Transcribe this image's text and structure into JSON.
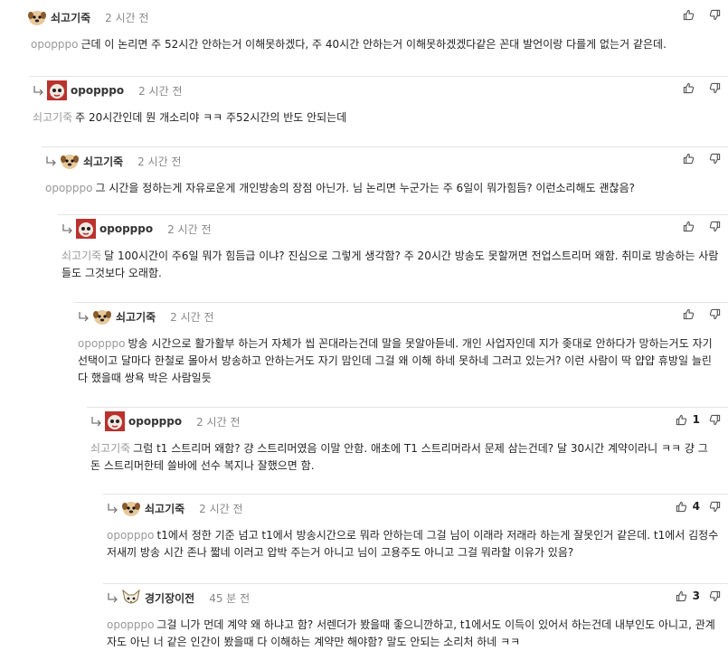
{
  "comments": [
    {
      "author": "쇠고기죽",
      "avatar": "dog-avatar-icon",
      "time": "2 시간 전",
      "mention": "opopppo",
      "text": "근데 이 논리면 주 52시간 안하는거 이해못하겠다, 주 40시간 안하는거 이해못하겠겠다같은 꼰대 발언이랑 다를게 없는거 같은데.",
      "likes": ""
    },
    {
      "author": "opopppo",
      "avatar": "face-avatar-icon",
      "time": "2 시간 전",
      "mention": "쇠고기죽",
      "text": "주 20시간인데 뭔 개소리야 ㅋㅋ 주52시간의 반도 안되는데",
      "likes": ""
    },
    {
      "author": "쇠고기죽",
      "avatar": "dog-avatar-icon",
      "time": "2 시간 전",
      "mention": "opopppo",
      "text": "그 시간을 정하는게 자유로운게 개인방송의 장점 아닌가. 님 논리면 누군가는 주 6일이 뭐가힘듬? 이런소리해도 괜찮음?",
      "likes": ""
    },
    {
      "author": "opopppo",
      "avatar": "face-avatar-icon",
      "time": "2 시간 전",
      "mention": "쇠고기죽",
      "text": "달 100시간이 주6일 뭐가 힘듬급 이냐? 진심으로 그렇게 생각함? 주 20시간 방송도 못할꺼면 전업스트리머 왜함. 취미로 방송하는 사람들도 그것보다 오래함.",
      "likes": ""
    },
    {
      "author": "쇠고기죽",
      "avatar": "dog-avatar-icon",
      "time": "2 시간 전",
      "mention": "opopppo",
      "text": "방송 시간으로 활가활부 하는거 자체가 씹 꼰대라는건데 말을 못알아듣네. 개인 사업자인데 지가 좆대로 안하다가 망하는거도 자기 선택이고 달마다 한철로 몰아서 방송하고 안하는거도 자기 맘인데 그걸 왜 이해 하네 못하네 그러고 있는거? 이런 사람이 딱 얍얍 휴방일 늘린다 했을때 쌍욕 박은 사람일듯",
      "likes": ""
    },
    {
      "author": "opopppo",
      "avatar": "face-avatar-icon",
      "time": "2 시간 전",
      "mention": "쇠고기죽",
      "text": "그럼 t1 스트리머 왜함? 걍 스트리머였음 이말 안함. 애초에 T1 스트리머라서 문제 삼는건데? 달 30시간 계약이라니 ㅋㅋ 걍 그 돈 스트리머한테 쓸바에 선수 복지나 잘했으면 함.",
      "likes": "1"
    },
    {
      "author": "쇠고기죽",
      "avatar": "dog-avatar-icon",
      "time": "2 시간 전",
      "mention": "opopppo",
      "text": "t1에서 정한 기준 넘고 t1에서 방송시간으로 뭐라 안하는데 그걸 님이 이래라 저래라 하는게 잘못인거 같은데. t1에서 김정수 저새끼 방송 시간 존나 짧네 이러고 압박 주는거 아니고 님이 고용주도 아니고 그걸 뭐라할 이유가 있음?",
      "likes": "4"
    },
    {
      "author": "경기장이전",
      "avatar": "fox-avatar-icon",
      "time": "45 분 전",
      "mention": "opopppo",
      "text": "그걸 니가 먼데 계약 왜 하냐고 함? 서렌더가 봤을때 좋으니깐하고, t1에서도 이득이 있어서 하는건데 내부인도 아니고, 관계자도 아닌 너 같은 인간이 봤을때 다 이해하는 계약만 해야함? 말도 안되는 소리처 하네 ㅋㅋ",
      "likes": "3"
    }
  ]
}
